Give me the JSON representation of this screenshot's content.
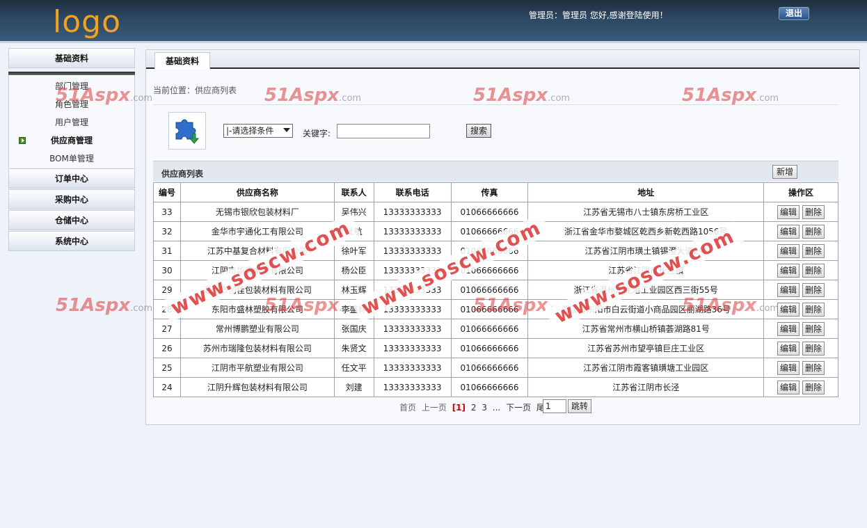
{
  "header": {
    "logo": "logo",
    "welcome": "管理员：管理员  您好,感谢登陆使用！",
    "logout_label": "退出"
  },
  "sidebar": {
    "base_title": "基础资料",
    "items": [
      {
        "label": "部门管理",
        "active": false
      },
      {
        "label": "角色管理",
        "active": false
      },
      {
        "label": "用户管理",
        "active": false
      },
      {
        "label": "供应商管理",
        "active": true
      },
      {
        "label": "BOM单管理",
        "active": false
      }
    ],
    "groups": [
      "订单中心",
      "采购中心",
      "仓储中心",
      "系统中心"
    ]
  },
  "main": {
    "tab_label": "基础资料",
    "location": "当前位置：供应商列表",
    "select_value": "|-请选择条件",
    "keyword_label": "关键字:",
    "keyword_value": "",
    "search_label": "搜索",
    "list_title": "供应商列表",
    "add_label": "新增"
  },
  "table": {
    "columns": [
      "编号",
      "供应商名称",
      "联系人",
      "联系电话",
      "传真",
      "地址",
      "操作区"
    ],
    "edit_label": "编辑",
    "delete_label": "删除",
    "rows": [
      [
        "33",
        "无锡市银欣包装材料厂",
        "吴伟兴",
        "13333333333",
        "01066666666",
        "江苏省无锡市八士镇东房桥工业区"
      ],
      [
        "32",
        "金华市宇通化工有限公司",
        "杜航",
        "13333333333",
        "01066666666",
        "浙江省金华市婺城区乾西乡新乾西路1056号"
      ],
      [
        "31",
        "江苏中基复合材料有限公司",
        "徐叶军",
        "13333333333",
        "01066666666",
        "江苏省江阴市璜土镇锡澄大道2号"
      ],
      [
        "30",
        "江阴市华奥木业有限公司",
        "杨公臣",
        "13333333333",
        "01066666666",
        "江苏省江阴市长泾镇"
      ],
      [
        "29",
        "温州市创佳包装材料有限公司",
        "林玉辉",
        "13333333333",
        "01066666666",
        "浙江省温州市龙港工业园区西三街55号"
      ],
      [
        "28",
        "东阳市盛林塑胶有限公司",
        "李盛林",
        "13333333333",
        "01066666666",
        "浙江省东阳市白云街道小商品园区丽湖路36号"
      ],
      [
        "27",
        "常州博鹏塑业有限公司",
        "张国庆",
        "13333333333",
        "01066666666",
        "江苏省常州市横山桥镇荟湖路81号"
      ],
      [
        "26",
        "苏州市瑞隆包装材料有限公司",
        "朱贤文",
        "13333333333",
        "01066666666",
        "江苏省苏州市望亭镇巨庄工业区"
      ],
      [
        "25",
        "江阴市平航塑业有限公司",
        "任文平",
        "13333333333",
        "01066666666",
        "江苏省江阴市霞客镇璜塘工业园区"
      ],
      [
        "24",
        "江阴升辉包装材料有限公司",
        "刘建",
        "13333333333",
        "01066666666",
        "江苏省江阴市长泾"
      ]
    ]
  },
  "pager": {
    "first": "首页",
    "prev": "上一页",
    "current": "[1]",
    "p2": "2",
    "p3": "3",
    "ellipsis": "...",
    "next": "下一页",
    "last": "尾页",
    "page_value": "1",
    "jump_label": "跳转"
  },
  "watermarks": {
    "aspx": "51Aspx",
    "aspx_com": ".com",
    "sos": "www.soscw.com"
  }
}
